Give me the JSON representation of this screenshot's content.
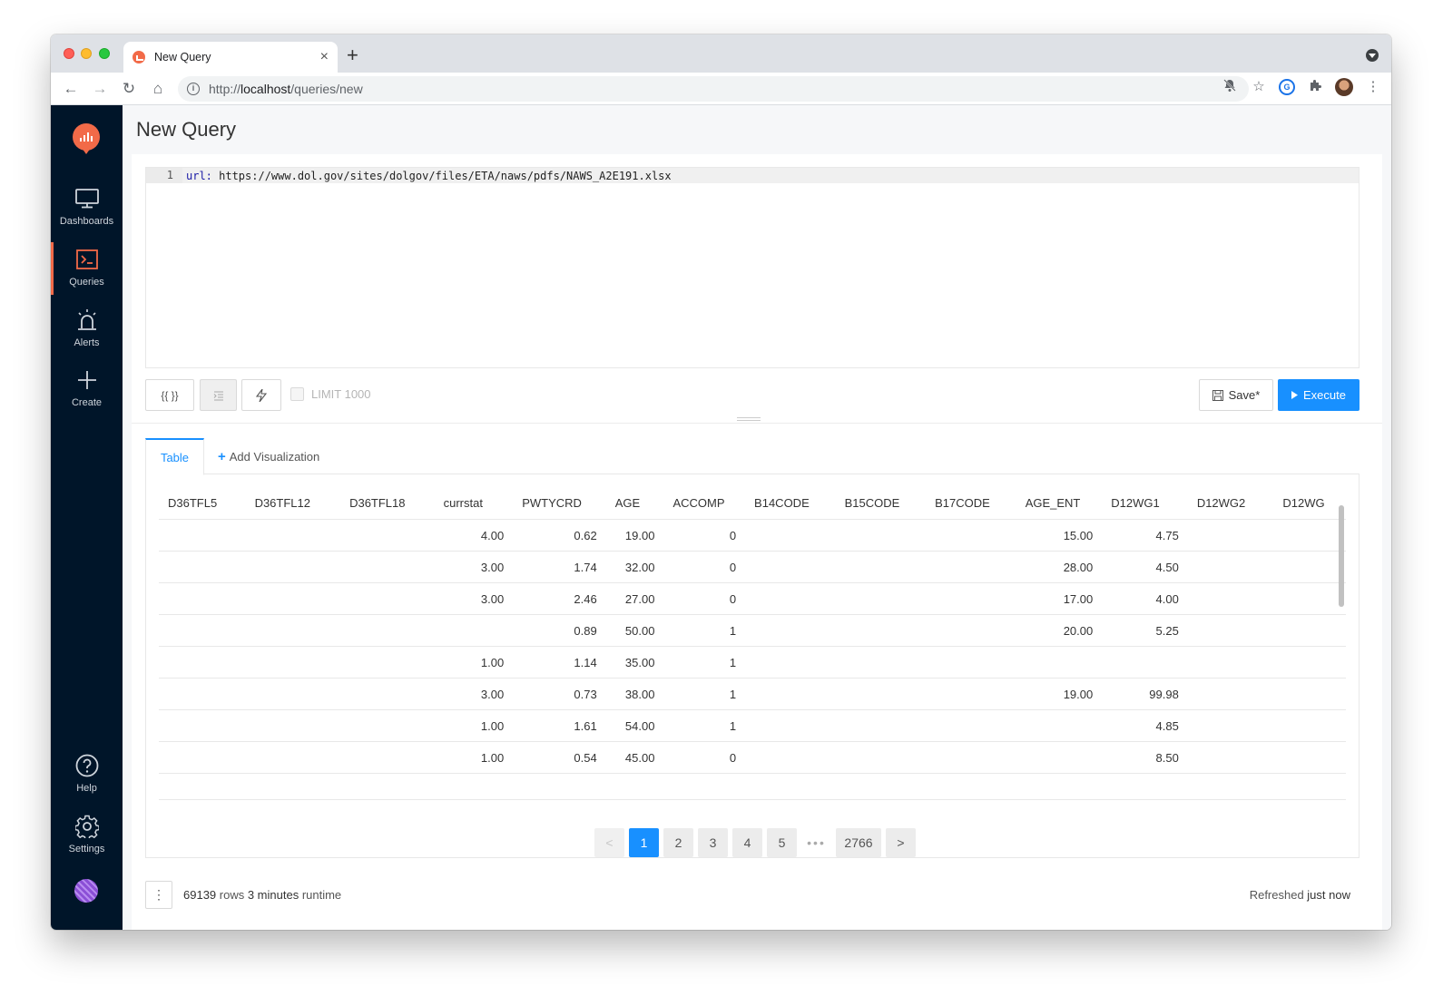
{
  "browser": {
    "tab_title": "New Query",
    "tab_close": "×",
    "new_tab": "+",
    "url_scheme": "http://",
    "url_host": "localhost",
    "url_path": "/queries/new"
  },
  "sidebar": {
    "items": [
      {
        "label": "Dashboards"
      },
      {
        "label": "Queries"
      },
      {
        "label": "Alerts"
      },
      {
        "label": "Create"
      },
      {
        "label": "Help"
      },
      {
        "label": "Settings"
      }
    ]
  },
  "page": {
    "title": "New Query"
  },
  "editor": {
    "line_number": "1",
    "keyword": "url:",
    "code": " https://www.dol.gov/sites/dolgov/files/ETA/naws/pdfs/NAWS_A2E191.xlsx"
  },
  "query_toolbar": {
    "params_label": "{{ }}",
    "limit_label": "LIMIT 1000",
    "save_label": "Save*",
    "execute_label": "Execute"
  },
  "results": {
    "tab_table": "Table",
    "add_visualization": "Add Visualization",
    "columns": [
      "D36TFL5",
      "D36TFL12",
      "D36TFL18",
      "currstat",
      "PWTYCRD",
      "AGE",
      "ACCOMP",
      "B14CODE",
      "B15CODE",
      "B17CODE",
      "AGE_ENT",
      "D12WG1",
      "D12WG2",
      "D12WG"
    ],
    "rows": [
      [
        "",
        "",
        "",
        "4.00",
        "0.62",
        "19.00",
        "0",
        "",
        "",
        "",
        "15.00",
        "4.75",
        "",
        ""
      ],
      [
        "",
        "",
        "",
        "3.00",
        "1.74",
        "32.00",
        "0",
        "",
        "",
        "",
        "28.00",
        "4.50",
        "",
        ""
      ],
      [
        "",
        "",
        "",
        "3.00",
        "2.46",
        "27.00",
        "0",
        "",
        "",
        "",
        "17.00",
        "4.00",
        "",
        ""
      ],
      [
        "",
        "",
        "",
        "",
        "0.89",
        "50.00",
        "1",
        "",
        "",
        "",
        "20.00",
        "5.25",
        "",
        ""
      ],
      [
        "",
        "",
        "",
        "1.00",
        "1.14",
        "35.00",
        "1",
        "",
        "",
        "",
        "",
        "",
        "",
        ""
      ],
      [
        "",
        "",
        "",
        "3.00",
        "0.73",
        "38.00",
        "1",
        "",
        "",
        "",
        "19.00",
        "99.98",
        "",
        ""
      ],
      [
        "",
        "",
        "",
        "1.00",
        "1.61",
        "54.00",
        "1",
        "",
        "",
        "",
        "",
        "4.85",
        "",
        ""
      ],
      [
        "",
        "",
        "",
        "1.00",
        "0.54",
        "45.00",
        "0",
        "",
        "",
        "",
        "",
        "8.50",
        "",
        ""
      ]
    ],
    "pagination": {
      "prev": "<",
      "pages": [
        "1",
        "2",
        "3",
        "4",
        "5"
      ],
      "ellipsis": "•••",
      "last": "2766",
      "next": ">"
    }
  },
  "footer": {
    "menu": "⋮",
    "rows_count": "69139",
    "rows_label": " rows ",
    "runtime_value": "3 minutes",
    "runtime_label": " runtime",
    "refreshed_label": "Refreshed ",
    "refreshed_value": "just now"
  },
  "colors": {
    "accent": "#1890ff",
    "brand": "#f26a48",
    "sidebar_bg": "#001529"
  }
}
